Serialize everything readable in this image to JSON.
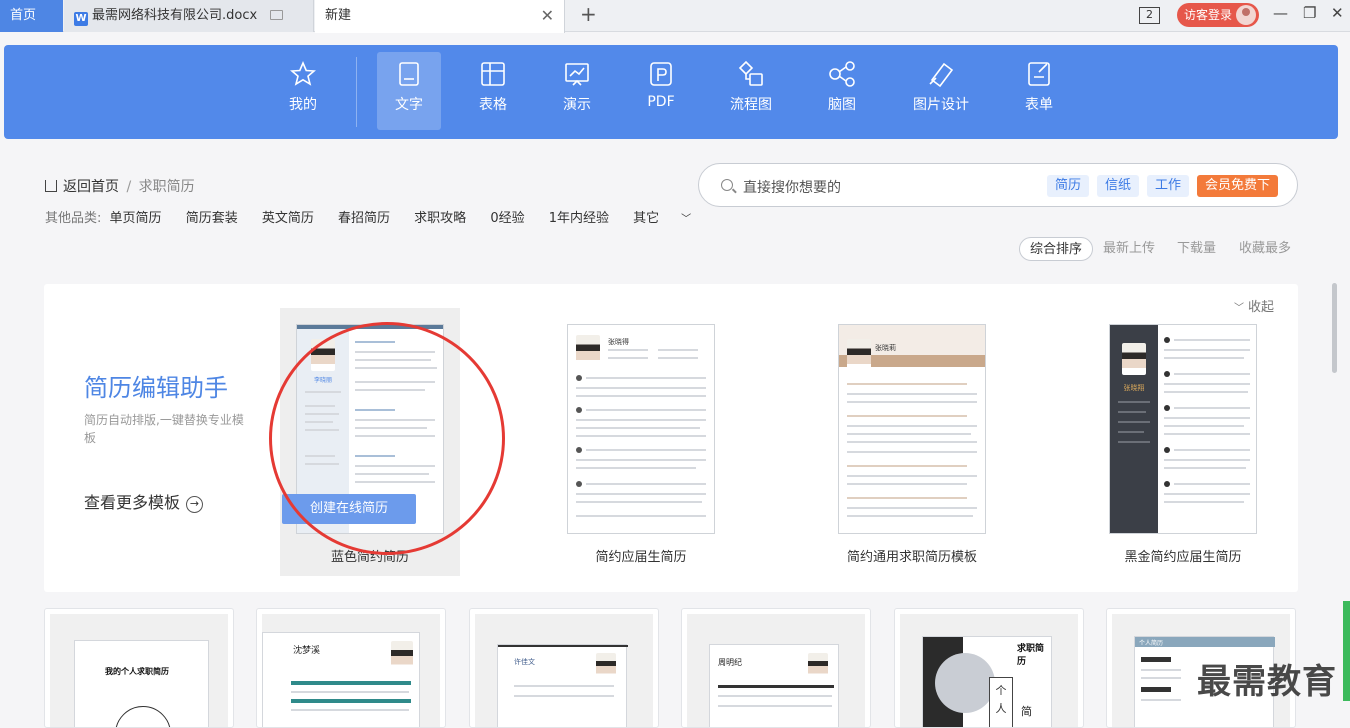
{
  "tabs": {
    "home": "首页",
    "doc": "最需网络科技有限公司.docx",
    "new": "新建",
    "close": "✕",
    "add": "+",
    "badge": "2",
    "login": "访客登录",
    "minimize": "—",
    "restore": "❐",
    "close_window": "✕"
  },
  "nav": {
    "items": [
      {
        "label": "我的",
        "icon": "star-icon"
      },
      {
        "label": "文字",
        "icon": "document-icon"
      },
      {
        "label": "表格",
        "icon": "table-icon"
      },
      {
        "label": "演示",
        "icon": "presentation-icon"
      },
      {
        "label": "PDF",
        "icon": "pdf-icon"
      },
      {
        "label": "流程图",
        "icon": "flowchart-icon"
      },
      {
        "label": "脑图",
        "icon": "mindmap-icon"
      },
      {
        "label": "图片设计",
        "icon": "image-design-icon"
      },
      {
        "label": "表单",
        "icon": "form-icon"
      }
    ],
    "accent": "#5289ea"
  },
  "breadcrumb": {
    "home": "返回首页",
    "sep": "/",
    "current": "求职简历"
  },
  "categories": {
    "label": "其他品类:",
    "items": [
      "单页简历",
      "简历套装",
      "英文简历",
      "春招简历",
      "求职攻略",
      "0经验",
      "1年内经验",
      "其它"
    ]
  },
  "search": {
    "placeholder": "直接搜你想要的",
    "tags": [
      "简历",
      "信纸",
      "工作"
    ],
    "vip": "会员免费下"
  },
  "sort": [
    "综合排序",
    "最新上传",
    "下载量",
    "收藏最多"
  ],
  "panel": {
    "collapse": "收起",
    "helper_title": "简历编辑助手",
    "helper_desc": "简历自动排版,一键替换专业模板",
    "more": "查看更多模板",
    "create": "创建在线简历",
    "templates": [
      {
        "name": "蓝色简约简历",
        "person": "李晓丽"
      },
      {
        "name": "简约应届生简历",
        "person": "张晓得"
      },
      {
        "name": "简约通用求职简历模板",
        "person": "张晓莉"
      },
      {
        "name": "黑金简约应届生简历",
        "person": "张晓翔"
      }
    ]
  },
  "grid": {
    "card1_title": "我的个人求职简历",
    "card2_name": "沈梦溪",
    "card3_name": "许佳文",
    "card4_name": "周明纪",
    "card5_title": "求职简历",
    "card5_sub1": "个",
    "card5_sub2": "人",
    "card5_sub3": "简",
    "card6_title": "个人简历"
  },
  "watermark": "最需教育",
  "highlight_color": "#e53a34"
}
